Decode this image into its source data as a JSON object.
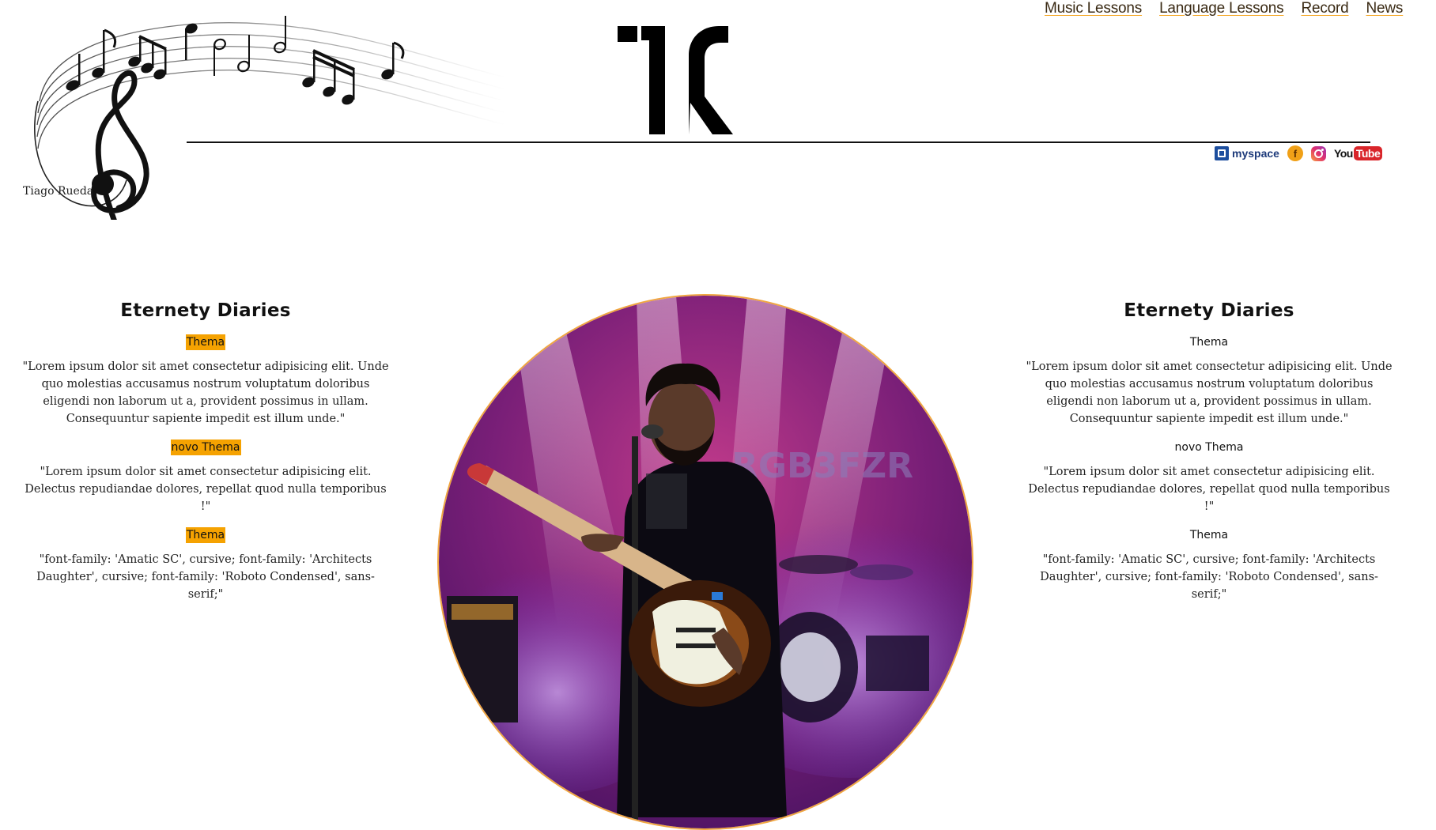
{
  "header": {
    "signature": "Tiago Rueda",
    "logo_text": "TR",
    "nav": [
      {
        "label": "Music Lessons"
      },
      {
        "label": "Language Lessons"
      },
      {
        "label": "Record"
      },
      {
        "label": "News"
      }
    ],
    "social": {
      "myspace": "myspace",
      "facebook": "f",
      "youtube_you": "You",
      "youtube_tube": "Tube"
    }
  },
  "columns": {
    "left": {
      "title": "Eternety Diaries",
      "theme1": "Thema",
      "text1": "\"Lorem ipsum dolor sit amet consectetur adipisicing elit. Unde quo molestias accusamus nostrum voluptatum doloribus eligendi non laborum ut a, provident possimus in ullam. Consequuntur sapiente impedit est illum unde.\"",
      "theme2": "novo Thema",
      "text2": "\"Lorem ipsum dolor sit amet consectetur adipisicing elit. Delectus repudiandae dolores, repellat quod nulla temporibus !\"",
      "theme3": "Thema",
      "text3": "\"font-family: 'Amatic SC', cursive; font-family: 'Architects Daughter', cursive; font-family: 'Roboto Condensed', sans-serif;\""
    },
    "right": {
      "title": "Eternety Diaries",
      "theme1": "Thema",
      "text1": "\"Lorem ipsum dolor sit amet consectetur adipisicing elit. Unde quo molestias accusamus nostrum voluptatum doloribus eligendi non laborum ut a, provident possimus in ullam. Consequuntur sapiente impedit est illum unde.\"",
      "theme2": "novo Thema",
      "text2": "\"Lorem ipsum dolor sit amet consectetur adipisicing elit. Delectus repudiandae dolores, repellat quod nulla temporibus !\"",
      "theme3": "Thema",
      "text3": "\"font-family: 'Amatic SC', cursive; font-family: 'Architects Daughter', cursive; font-family: 'Roboto Condensed', sans-serif;\""
    }
  },
  "colors": {
    "accent": "#f5a201",
    "nav_underline": "#f5a623",
    "text": "#222222"
  },
  "icons": [
    "music-staff-icon",
    "treble-clef-icon",
    "myspace-icon",
    "facebook-icon",
    "instagram-icon",
    "youtube-icon"
  ],
  "photo_alt": "guitarist on stage"
}
